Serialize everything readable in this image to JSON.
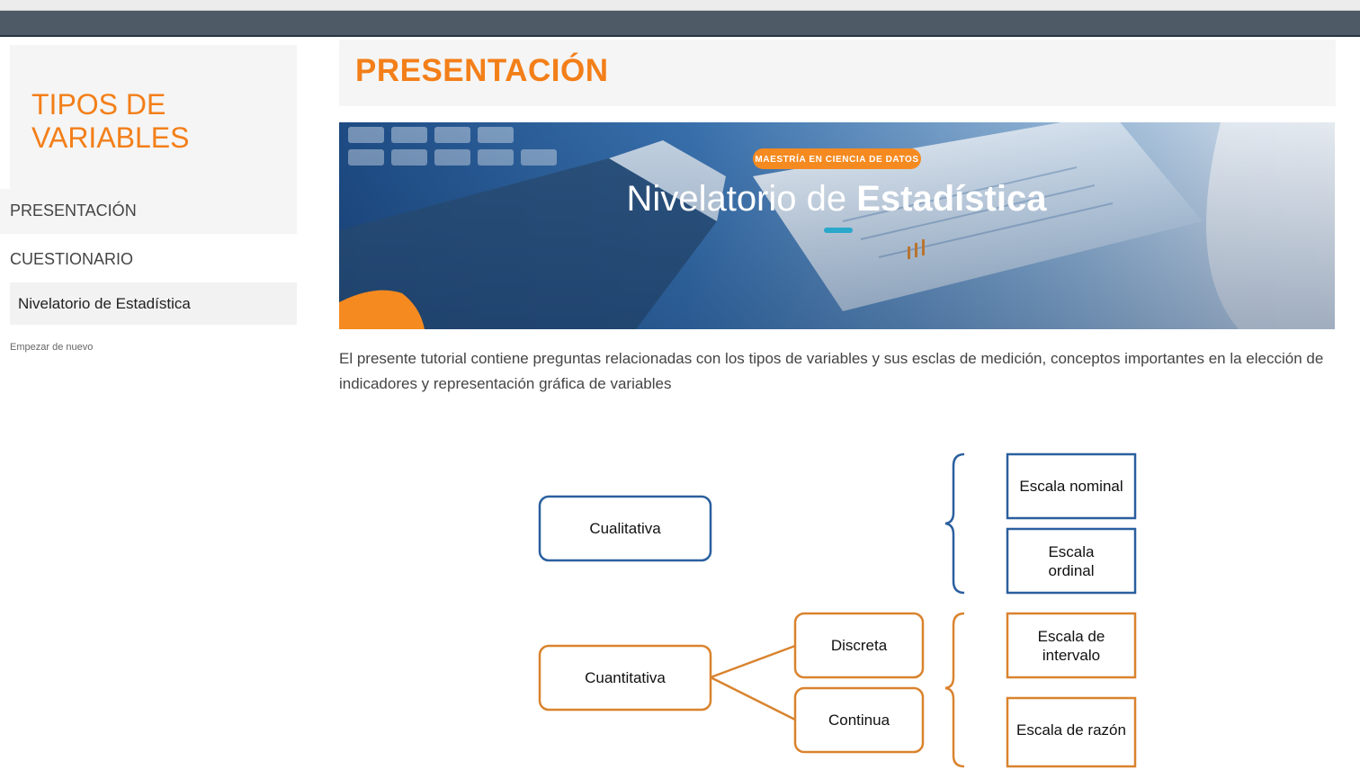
{
  "sidebar": {
    "title": "TIPOS DE VARIABLES",
    "items": [
      {
        "label": "PRESENTACIÓN"
      },
      {
        "label": "CUESTIONARIO"
      }
    ],
    "sub_item": "Nivelatorio de Estadística",
    "restart": "Empezar de nuevo"
  },
  "main": {
    "title": "PRESENTACIÓN",
    "banner": {
      "badge": "MAESTRÍA EN CIENCIA DE DATOS",
      "title_light": "Nivelatorio de ",
      "title_bold": "Estadística"
    },
    "intro": "El presente tutorial contiene preguntas relacionadas con los tipos de variables y sus esclas de medición, conceptos importantes en la elección de indicadores y representación gráfica de variables"
  },
  "diagram": {
    "cualitativa": "Cualitativa",
    "cuantitativa": "Cuantitativa",
    "discreta": "Discreta",
    "continua": "Continua",
    "escala_nominal": "Escala nominal",
    "escala_ordinal": "Escala\nordinal",
    "escala_intervalo": "Escala de\nintervalo",
    "escala_razon": "Escala de razón"
  },
  "colors": {
    "accent": "#f37f19",
    "topbar": "#4e5b66",
    "blue_box": "#2a5f9e",
    "orange_box": "#d9832e"
  }
}
